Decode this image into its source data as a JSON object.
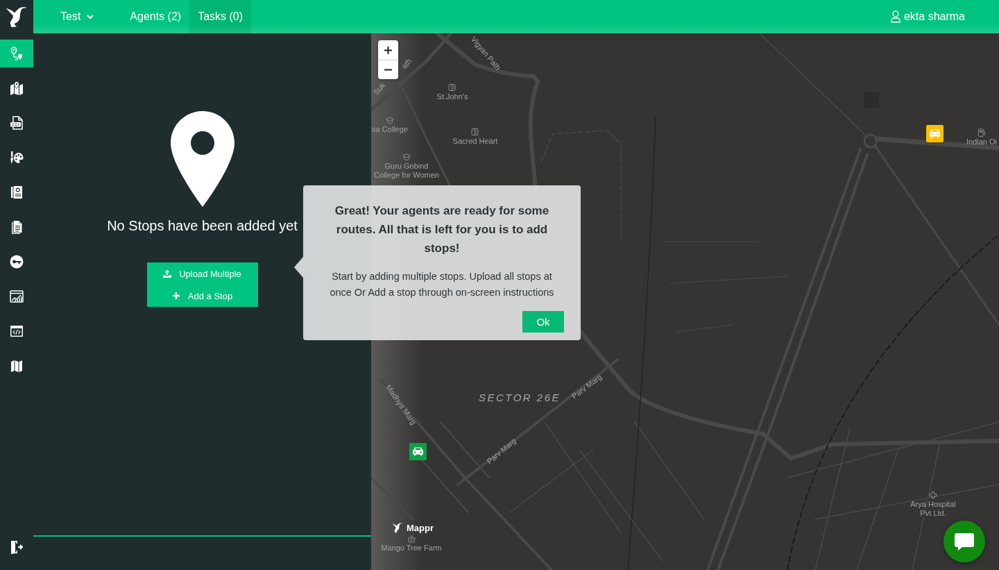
{
  "header": {
    "workspace": "Test",
    "tabs": [
      {
        "label": "Agents (2)",
        "selected": false
      },
      {
        "label": "Tasks (0)",
        "selected": true
      }
    ],
    "user": "ekta sharma"
  },
  "sidebar": {
    "items": [
      {
        "selected": true
      },
      {
        "selected": false
      },
      {
        "selected": false
      },
      {
        "selected": false
      },
      {
        "selected": false
      },
      {
        "selected": false
      },
      {
        "selected": false
      },
      {
        "selected": false
      },
      {
        "selected": false
      },
      {
        "selected": false
      }
    ]
  },
  "stops_panel": {
    "empty_message": "No Stops have been added yet",
    "buttons": [
      {
        "kind": "upload",
        "label": "Upload Multiple"
      },
      {
        "kind": "add",
        "label": "Add a Stop"
      }
    ]
  },
  "onboarding_popup": {
    "title": "Great! Your agents are ready for some routes. All that is left for you is to add stops!",
    "body": "Start by adding multiple stops. Upload all stops at once Or Add a stop through on-screen instructions",
    "button": "Ok"
  },
  "map": {
    "labels": [
      {
        "kind": "road",
        "text": "Vigyan Path"
      },
      {
        "kind": "road",
        "text": "Suk"
      },
      {
        "kind": "road",
        "text": "ath"
      },
      {
        "kind": "place",
        "text": "St.John's"
      },
      {
        "kind": "place",
        "text": "sa College"
      },
      {
        "kind": "place",
        "text": "Sacred Heart"
      },
      {
        "kind": "place",
        "text": "Guru Gobind College for Women"
      },
      {
        "kind": "place",
        "text": "Indian Oi"
      },
      {
        "kind": "district",
        "text": "SECTOR 26E"
      },
      {
        "kind": "road",
        "text": "Parv Marg"
      },
      {
        "kind": "road",
        "text": "Madhya Marg"
      },
      {
        "kind": "road",
        "text": "Parv Marg"
      },
      {
        "kind": "place",
        "text": "Arya Hospital Pvt Ltd."
      },
      {
        "kind": "place",
        "text": "Mango Tree Farm"
      }
    ],
    "markers": [
      {
        "color": "#ffbf00"
      },
      {
        "color": "#109f48"
      }
    ],
    "attribution": "Mappr"
  }
}
